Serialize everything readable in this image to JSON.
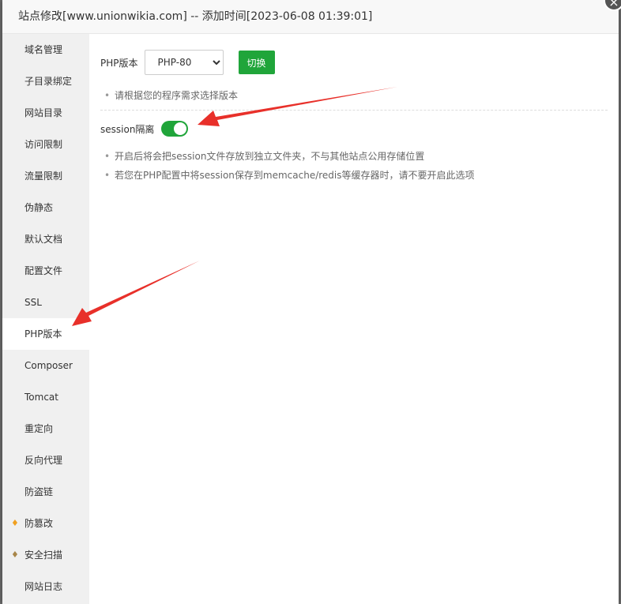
{
  "dialog": {
    "title": "站点修改[www.unionwikia.com] -- 添加时间[2023-06-08 01:39:01]",
    "close_icon": "×"
  },
  "sidebar": {
    "items": [
      {
        "label": "域名管理"
      },
      {
        "label": "子目录绑定"
      },
      {
        "label": "网站目录"
      },
      {
        "label": "访问限制"
      },
      {
        "label": "流量限制"
      },
      {
        "label": "伪静态"
      },
      {
        "label": "默认文档"
      },
      {
        "label": "配置文件"
      },
      {
        "label": "SSL"
      },
      {
        "label": "PHP版本",
        "active": true
      },
      {
        "label": "Composer"
      },
      {
        "label": "Tomcat"
      },
      {
        "label": "重定向"
      },
      {
        "label": "反向代理"
      },
      {
        "label": "防盗链"
      },
      {
        "label": "防篡改",
        "icon": "gold-gem-icon"
      },
      {
        "label": "安全扫描",
        "icon": "bronze-gem-icon"
      },
      {
        "label": "网站日志"
      }
    ]
  },
  "php": {
    "label": "PHP版本",
    "selected": "PHP-80",
    "switch_label": "切换",
    "tip": "请根据您的程序需求选择版本"
  },
  "session": {
    "label": "session隔离",
    "enabled": true,
    "tips": [
      "开启后将会把session文件存放到独立文件夹，不与其他站点公用存储位置",
      "若您在PHP配置中将session保存到memcache/redis等缓存器时，请不要开启此选项"
    ]
  },
  "colors": {
    "accent": "#20a53a",
    "arrow": "#e8302a"
  }
}
